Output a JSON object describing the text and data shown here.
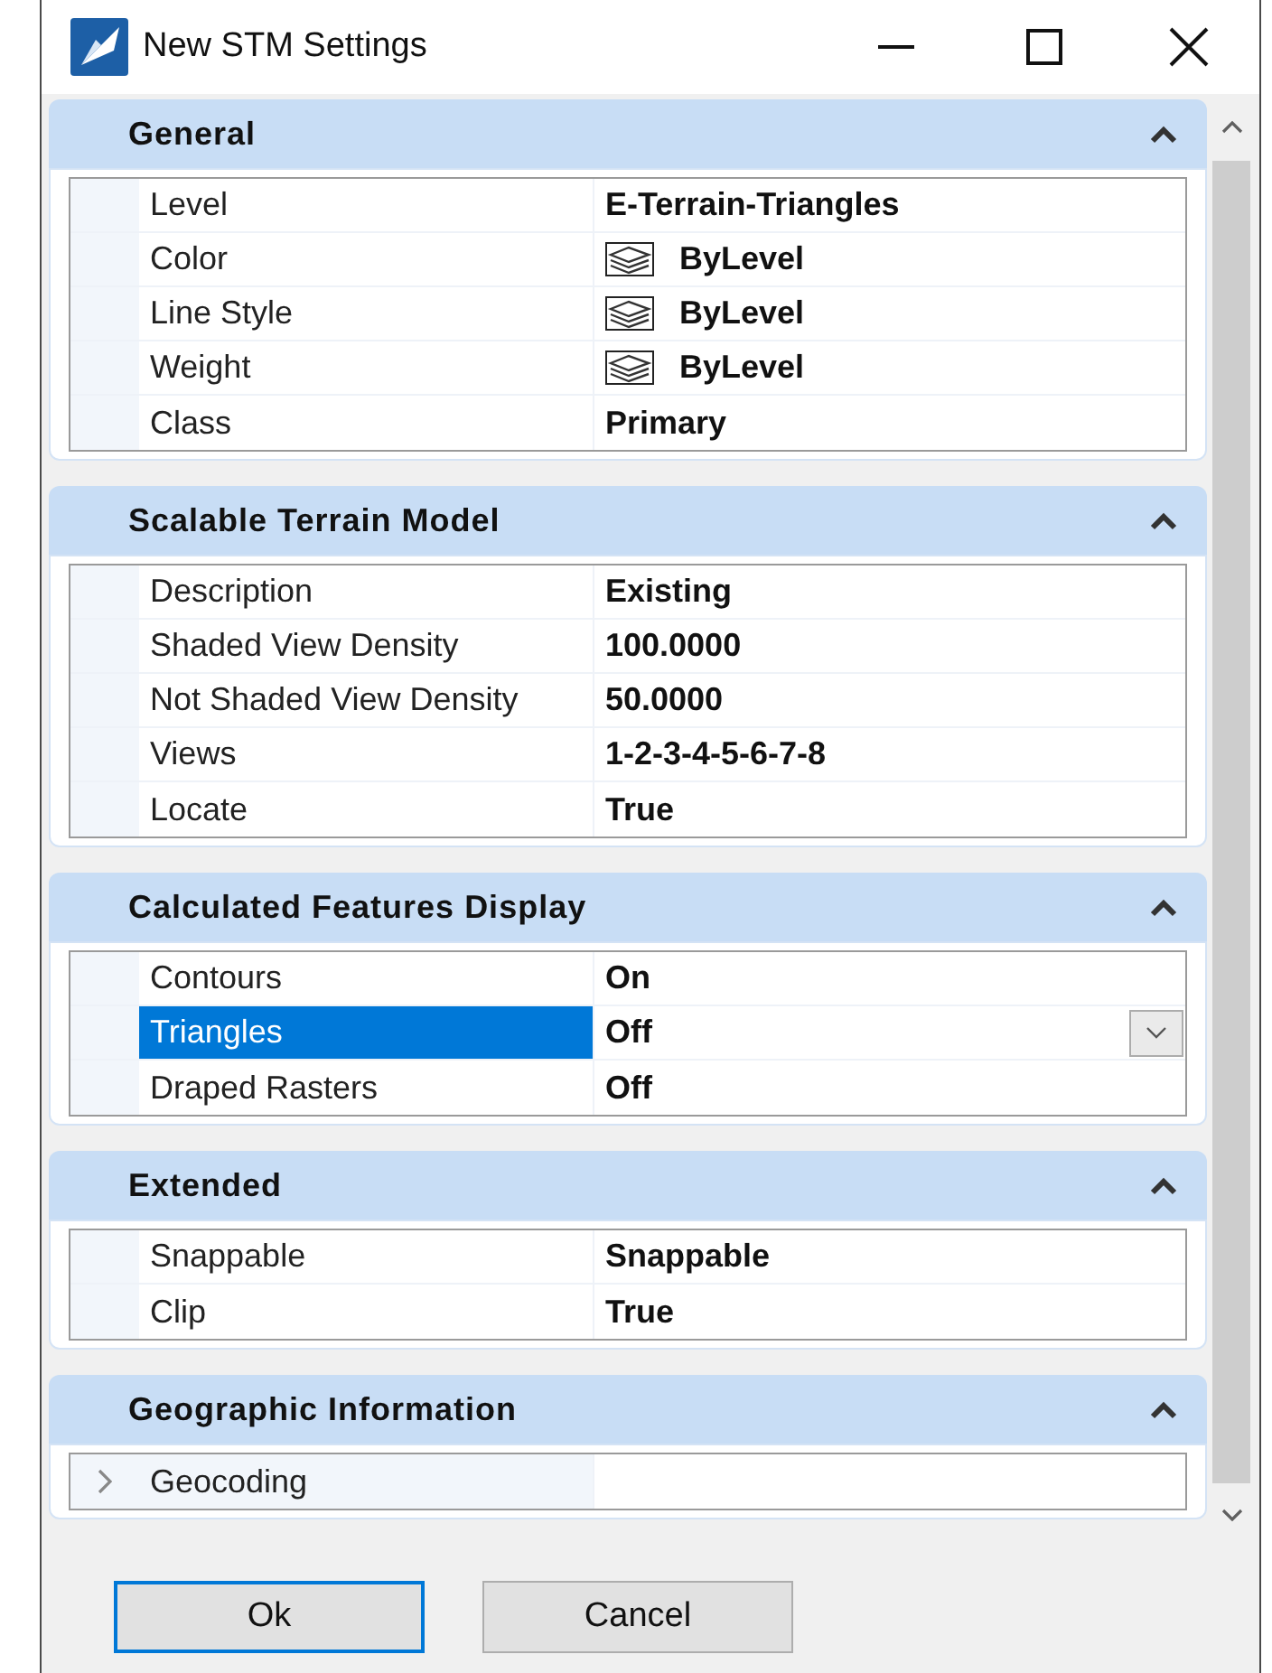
{
  "window": {
    "title": "New STM Settings"
  },
  "sections": [
    {
      "title": "General",
      "expanded": true,
      "rows": [
        {
          "kind": "text",
          "label": "Level",
          "value": "E-Terrain-Triangles",
          "selected": false
        },
        {
          "kind": "bylevel",
          "label": "Color",
          "value": "ByLevel",
          "selected": false
        },
        {
          "kind": "bylevel",
          "label": "Line Style",
          "value": "ByLevel",
          "selected": false
        },
        {
          "kind": "bylevel",
          "label": "Weight",
          "value": "ByLevel",
          "selected": false
        },
        {
          "kind": "text",
          "label": "Class",
          "value": "Primary",
          "selected": false
        }
      ]
    },
    {
      "title": "Scalable Terrain Model",
      "expanded": true,
      "rows": [
        {
          "kind": "text",
          "label": "Description",
          "value": "Existing",
          "selected": false
        },
        {
          "kind": "text",
          "label": "Shaded View Density",
          "value": "100.0000",
          "selected": false
        },
        {
          "kind": "text",
          "label": "Not Shaded View Density",
          "value": "50.0000",
          "selected": false
        },
        {
          "kind": "text",
          "label": "Views",
          "value": "1-2-3-4-5-6-7-8",
          "selected": false
        },
        {
          "kind": "text",
          "label": "Locate",
          "value": "True",
          "selected": false
        }
      ]
    },
    {
      "title": "Calculated Features Display",
      "expanded": true,
      "rows": [
        {
          "kind": "text",
          "label": "Contours",
          "value": "On",
          "selected": false
        },
        {
          "kind": "text",
          "label": "Triangles",
          "value": "Off",
          "selected": true
        },
        {
          "kind": "text",
          "label": "Draped Rasters",
          "value": "Off",
          "selected": false
        }
      ]
    },
    {
      "title": "Extended",
      "expanded": true,
      "rows": [
        {
          "kind": "text",
          "label": "Snappable",
          "value": "Snappable",
          "selected": false
        },
        {
          "kind": "text",
          "label": "Clip",
          "value": "True",
          "selected": false
        }
      ]
    },
    {
      "title": "Geographic Information",
      "expanded": true,
      "rows": [
        {
          "kind": "group",
          "label": "Geocoding",
          "expanded": false,
          "selected": false
        }
      ]
    }
  ],
  "buttons": [
    {
      "label": "Ok",
      "default": true
    },
    {
      "label": "Cancel",
      "default": false
    }
  ]
}
